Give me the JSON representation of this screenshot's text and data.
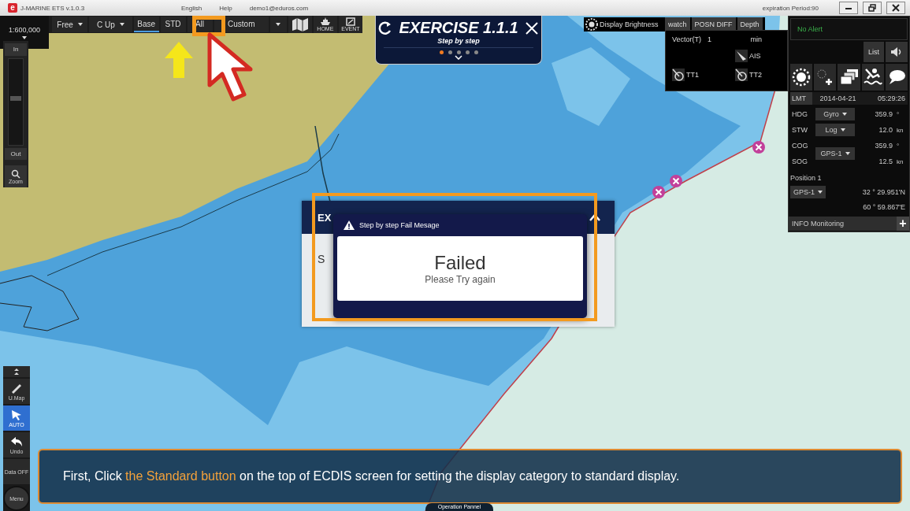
{
  "title_bar": {
    "logo": "e",
    "app": "J-MARINE ETS v.1.0.3",
    "menu": [
      "English",
      "Help"
    ],
    "user": "demo1@eduros.com",
    "expiration": "expiration Period:90"
  },
  "toolbar": {
    "scale": "1:600,000",
    "items": [
      {
        "kind": "dropdown",
        "label": "Free",
        "selected": false
      },
      {
        "kind": "dropdown",
        "label": "C Up",
        "selected": false
      },
      {
        "kind": "tab",
        "label": "Base",
        "selected": true
      },
      {
        "kind": "tab",
        "label": "STD",
        "selected": false
      },
      {
        "kind": "tab",
        "label": "All",
        "selected": false
      },
      {
        "kind": "tab",
        "label": "Custom",
        "selected": false
      },
      {
        "kind": "menu",
        "selected": false
      }
    ],
    "icon_buttons": [
      {
        "kind": "map"
      },
      {
        "kind": "home",
        "label": "HOME"
      },
      {
        "kind": "event",
        "label": "EVENT"
      }
    ]
  },
  "exercise": {
    "title": "EXERCISE 1.1.1",
    "subtitle": "Step by step",
    "steps": [
      {
        "selected": true
      },
      {
        "selected": false
      },
      {
        "selected": false
      },
      {
        "selected": false
      },
      {
        "selected": false
      }
    ]
  },
  "display": {
    "brightness": "Display Brightness",
    "tabs": [
      "watch",
      "POSN DIFF",
      "Depth"
    ],
    "vector_label": "Vector(T)",
    "vector_value": "1",
    "vector_unit": "min",
    "targets": [
      "AIS",
      "TT1",
      "TT2"
    ]
  },
  "alert": {
    "text": "No Alert",
    "list": "List"
  },
  "nav": {
    "lmt": {
      "label": "LMT",
      "date": "2014-04-21",
      "time": "05:29:26"
    },
    "rows": [
      {
        "label": "HDG",
        "source": "Gyro",
        "value": "359.9",
        "unit": "°"
      },
      {
        "label": "STW",
        "source": "Log",
        "value": "12.0",
        "unit": "kn"
      },
      {
        "label": "COG",
        "value": "359.9",
        "unit": "°"
      },
      {
        "label": "SOG",
        "value": "12.5",
        "unit": "kn"
      }
    ],
    "shared_source": "GPS-1",
    "position_label": "Position 1",
    "position_source": "GPS-1",
    "lat": "32 ° 29.951'N",
    "lon": "60 ° 59.867'E",
    "info": "INFO Monitoring",
    "info_button": "+"
  },
  "zoom": {
    "in": "In",
    "out": "Out",
    "label": "Zoom",
    "level": 0.55
  },
  "tools": [
    {
      "kind": "umap",
      "label": "U.Map",
      "selected": false
    },
    {
      "kind": "auto",
      "label": "AUTO",
      "selected": true
    },
    {
      "kind": "undo",
      "label": "Undo",
      "selected": false
    },
    {
      "kind": "data",
      "label": "Data OFF",
      "selected": false
    },
    {
      "kind": "menu",
      "label": "Menu",
      "selected": false
    }
  ],
  "back_dialog": {
    "title": "EX",
    "text": "S"
  },
  "fail_dialog": {
    "header": "Step by step Fail Mesage",
    "title": "Failed",
    "message": "Please Try again"
  },
  "instruction": {
    "before": "First, Click ",
    "highlight": "the Standard button",
    "after": " on the top of ECDIS screen for setting the display category to standard display."
  },
  "operation_panel": "Operation Pannel"
}
